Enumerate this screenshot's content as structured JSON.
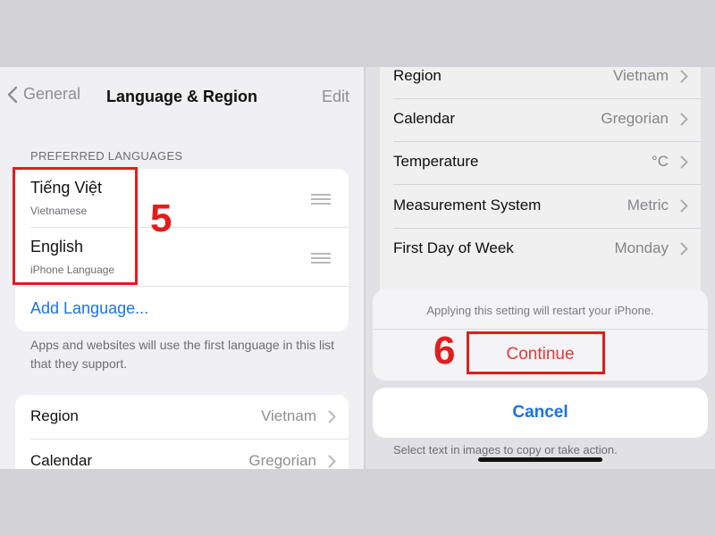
{
  "left": {
    "back_label": "General",
    "title": "Language & Region",
    "edit_label": "Edit",
    "preferred_languages_header": "PREFERRED LANGUAGES",
    "languages": [
      {
        "name": "Tiếng Việt",
        "subtitle": "Vietnamese"
      },
      {
        "name": "English",
        "subtitle": "iPhone Language"
      }
    ],
    "add_language": "Add Language...",
    "note": "Apps and websites will use the first language in this list that they support.",
    "rows": [
      {
        "label": "Region",
        "value": "Vietnam"
      },
      {
        "label": "Calendar",
        "value": "Gregorian"
      }
    ]
  },
  "right": {
    "rows": [
      {
        "label": "Region",
        "value": "Vietnam"
      },
      {
        "label": "Calendar",
        "value": "Gregorian"
      },
      {
        "label": "Temperature",
        "value": "°C"
      },
      {
        "label": "Measurement System",
        "value": "Metric"
      },
      {
        "label": "First Day of Week",
        "value": "Monday"
      }
    ],
    "alert_message": "Applying this setting will restart your iPhone.",
    "continue_label": "Continue",
    "cancel_label": "Cancel",
    "footer_note": "Select text in images to copy or take action."
  },
  "annotations": {
    "step_5": "5",
    "step_6": "6",
    "highlight_color": "#e11d1d"
  },
  "colors": {
    "accent_blue": "#1a73e8",
    "destructive_red": "#e53935"
  }
}
